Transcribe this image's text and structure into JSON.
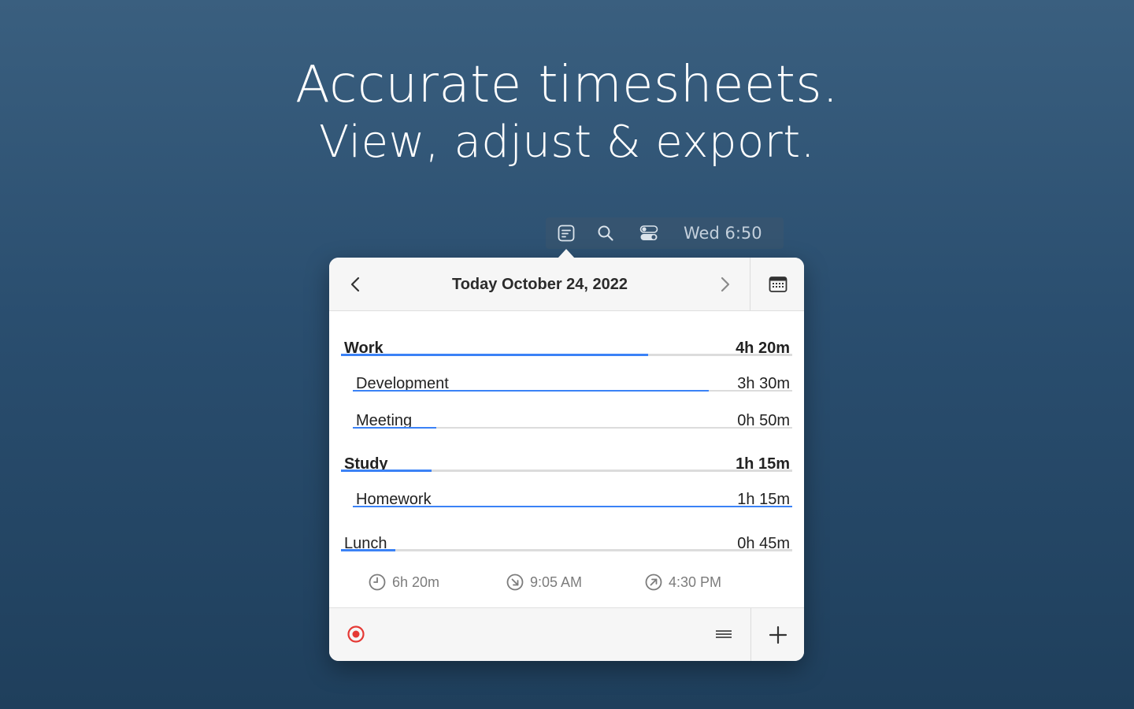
{
  "headline": {
    "line1": "Accurate timesheets.",
    "line2": "View, adjust & export."
  },
  "menubar": {
    "icons": [
      "timesheet-icon",
      "search-icon",
      "toggles-icon"
    ],
    "clock": "Wed 6:50"
  },
  "panel": {
    "header": {
      "title": "Today October 24, 2022",
      "prev_icon": "chevron-left-icon",
      "next_icon": "chevron-right-icon",
      "calendar_icon": "calendar-icon"
    },
    "entries": [
      {
        "label": "Work",
        "value": "4h 20m",
        "progress": 0.68
      },
      {
        "label": "Development",
        "value": "3h 30m",
        "progress": 0.81
      },
      {
        "label": "Meeting",
        "value": "0h 50m",
        "progress": 0.19
      },
      {
        "label": "Study",
        "value": "1h 15m",
        "progress": 0.2
      },
      {
        "label": "Homework",
        "value": "1h 15m",
        "progress": 1.0
      },
      {
        "label": "Lunch",
        "value": "0h 45m",
        "progress": 0.12
      }
    ],
    "summary": {
      "total": "6h 20m",
      "start": "9:05 AM",
      "end": "4:30 PM"
    },
    "footer": {
      "record_icon": "record-icon",
      "list_icon": "list-icon",
      "add_icon": "plus-icon"
    },
    "colors": {
      "accent": "#3b82f6",
      "record": "#e53935",
      "track": "#dcdcdc"
    }
  }
}
